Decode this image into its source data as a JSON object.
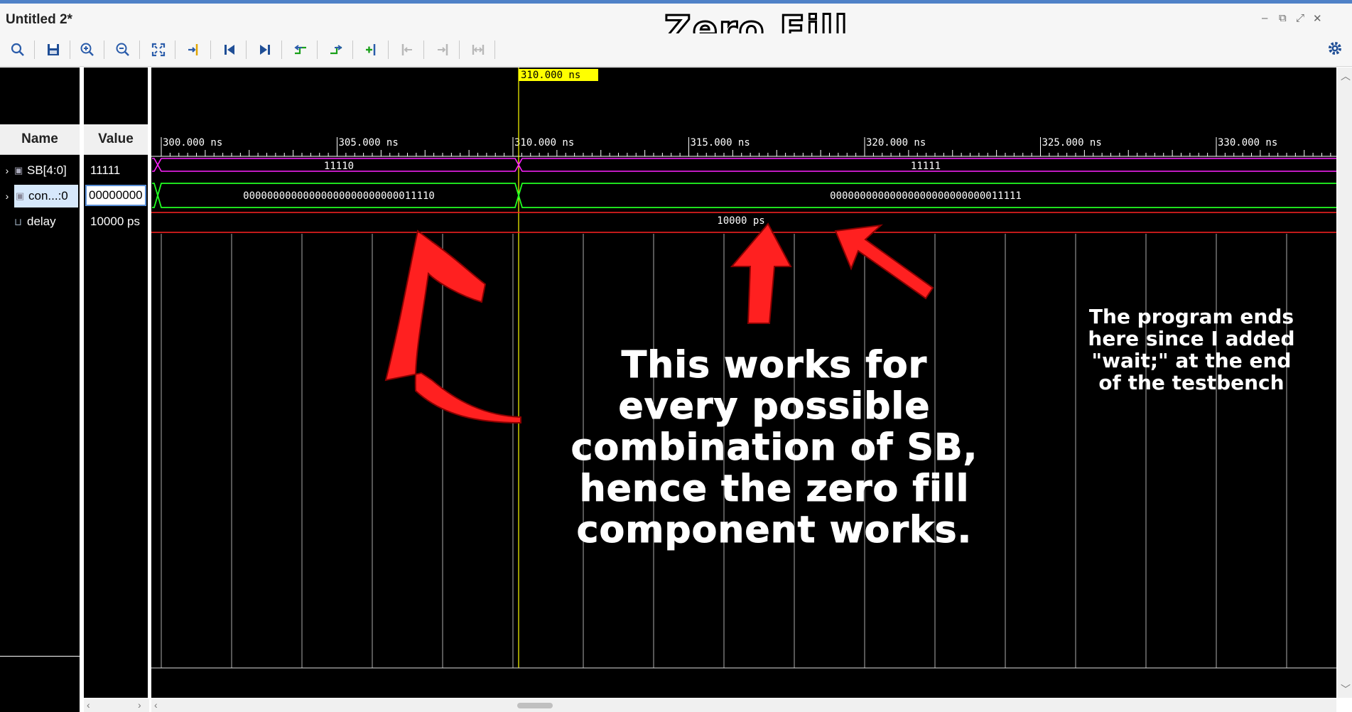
{
  "window": {
    "title": "Untitled 2*",
    "overlay_title": "Zero Fill"
  },
  "toolbar": {
    "icons": [
      "search-icon",
      "save-icon",
      "zoom-in-icon",
      "zoom-out-icon",
      "zoom-fit-icon",
      "go-to-cursor-icon",
      "go-to-start-icon",
      "go-to-end-icon",
      "previous-transition-icon",
      "next-transition-icon",
      "add-marker-icon",
      "previous-marker-icon",
      "next-marker-icon",
      "swap-cursors-icon",
      "settings-icon"
    ]
  },
  "panels": {
    "name_header": "Name",
    "value_header": "Value"
  },
  "signals": [
    {
      "name": "SB[4:0]",
      "value": "11111",
      "icon": "bus-icon"
    },
    {
      "name": "con...:0",
      "value": "00000000",
      "icon": "bus-icon"
    },
    {
      "name": "delay",
      "value": "10000 ps",
      "icon": "constant-icon"
    }
  ],
  "waveform": {
    "cursor_label": "310.000 ns",
    "time_labels": [
      "300.000 ns",
      "305.000 ns",
      "310.000 ns",
      "315.000 ns",
      "320.000 ns",
      "325.000 ns",
      "330.000 ns"
    ],
    "sb_before": "11110",
    "sb_after": "11111",
    "con_before": "00000000000000000000000000011110",
    "con_after": "00000000000000000000000000011111",
    "delay_value": "10000 ps",
    "colors": {
      "bus": "#ff00ff",
      "bus2": "#00ff00",
      "delay": "#ff0000",
      "cursor": "#ffff00"
    }
  },
  "annotations": {
    "main": [
      "This works for",
      "every possible",
      "combination of SB,",
      "hence the zero fill",
      "component works."
    ],
    "side": [
      "The program ends",
      "here since I added",
      "\"wait;\" at the end",
      "of the testbench"
    ]
  }
}
